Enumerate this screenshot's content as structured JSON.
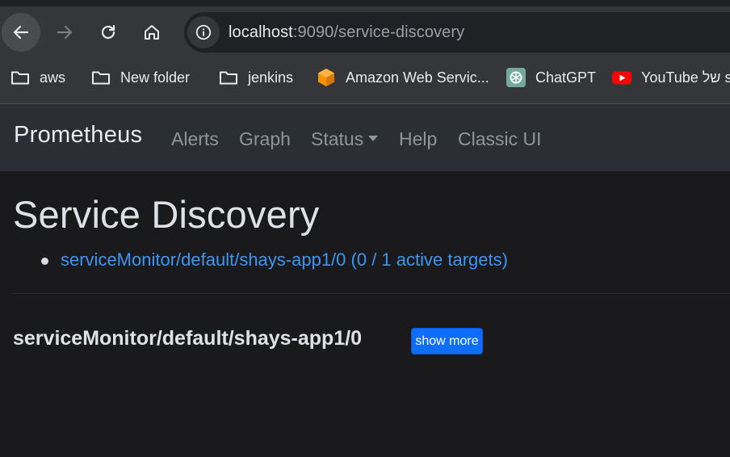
{
  "browser": {
    "url_host": "localhost",
    "url_rest": ":9090/service-discovery",
    "bookmarks": [
      {
        "label": "aws",
        "icon": "folder-icon"
      },
      {
        "label": "New folder",
        "icon": "folder-icon"
      },
      {
        "label": "jenkins",
        "icon": "folder-icon"
      },
      {
        "label": "Amazon Web Servic...",
        "icon": "aws-orange-cube-icon"
      },
      {
        "label": "ChatGPT",
        "icon": "chatgpt-icon"
      },
      {
        "label": "YouTube של sh",
        "icon": "youtube-icon"
      }
    ]
  },
  "navbar": {
    "brand": "Prometheus",
    "links": [
      "Alerts",
      "Graph",
      "Status",
      "Help",
      "Classic UI"
    ]
  },
  "main": {
    "title": "Service Discovery",
    "targets_list": [
      "serviceMonitor/default/shays-app1/0 (0 / 1 active targets)"
    ],
    "section_heading": "serviceMonitor/default/shays-app1/0",
    "show_more_label": "show more"
  },
  "colors": {
    "link": "#3b96f4",
    "button": "#0d6efd",
    "navbar": "#2b2f35",
    "page_bg": "#1a1a1c"
  }
}
